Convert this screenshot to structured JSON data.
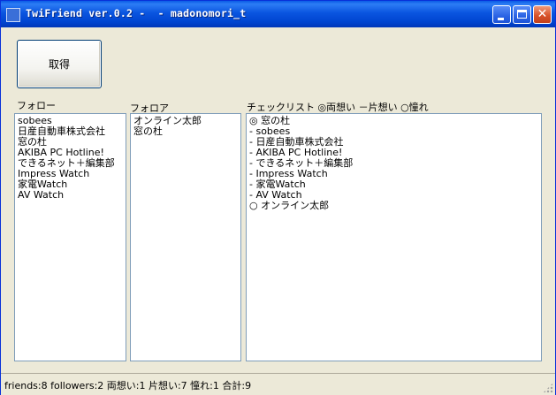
{
  "window": {
    "title": "TwiFriend ver.0.2 -  - madonomori_t"
  },
  "toolbar": {
    "fetch_label": "取得"
  },
  "follow": {
    "label": "フォロー",
    "items": [
      "sobees",
      "日産自動車株式会社",
      "窓の杜",
      "AKIBA PC Hotline!",
      "できるネット＋編集部",
      "Impress Watch",
      "家電Watch",
      "AV Watch"
    ]
  },
  "followers": {
    "label": "フォロア",
    "items": [
      "オンライン太郎",
      "窓の杜"
    ]
  },
  "checklist": {
    "label": "チェックリスト ◎両想い －片想い ○憧れ",
    "items": [
      "◎ 窓の杜",
      "- sobees",
      "- 日産自動車株式会社",
      "- AKIBA PC Hotline!",
      "- できるネット＋編集部",
      "- Impress Watch",
      "- 家電Watch",
      "- AV Watch",
      "○ オンライン太郎"
    ]
  },
  "status": {
    "text": "friends:8 followers:2 両想い:1 片想い:7 憧れ:1 合計:9"
  }
}
